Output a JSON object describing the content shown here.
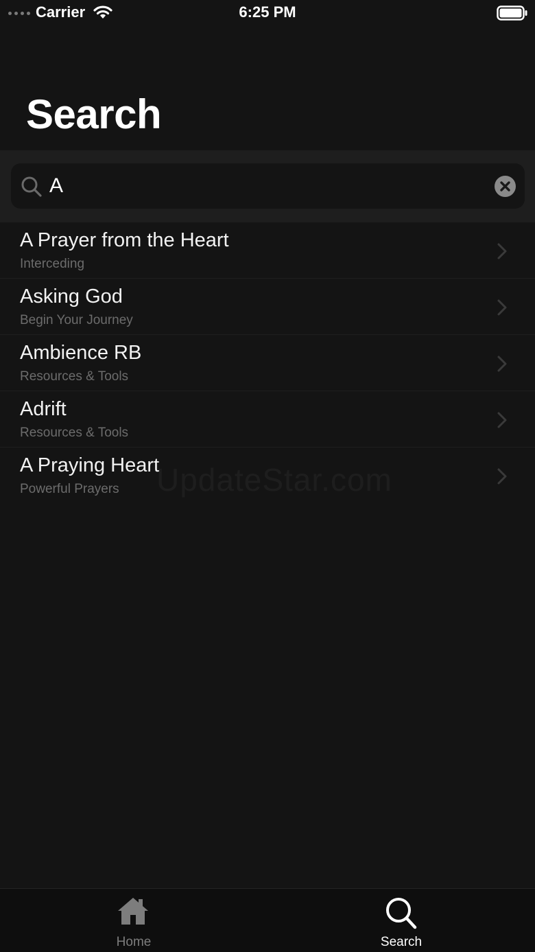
{
  "status_bar": {
    "carrier": "Carrier",
    "time": "6:25 PM"
  },
  "page": {
    "title": "Search"
  },
  "search": {
    "query": "A",
    "icon": "search-icon",
    "clear_icon": "clear-icon"
  },
  "results": [
    {
      "title": "A Prayer from the Heart",
      "subtitle": "Interceding"
    },
    {
      "title": "Asking God",
      "subtitle": "Begin Your Journey"
    },
    {
      "title": "Ambience RB",
      "subtitle": "Resources & Tools"
    },
    {
      "title": "Adrift",
      "subtitle": "Resources & Tools"
    },
    {
      "title": "A Praying Heart",
      "subtitle": "Powerful Prayers"
    }
  ],
  "watermark": "UpdateStar.com",
  "tab_bar": {
    "tabs": [
      {
        "label": "Home",
        "icon": "home-icon",
        "selected": false
      },
      {
        "label": "Search",
        "icon": "search-icon",
        "selected": true
      }
    ]
  },
  "colors": {
    "background": "#141414",
    "search_band": "#1e1e1e",
    "subtitle_text": "#6c6c6c",
    "tab_inactive": "#7d7d7d",
    "tab_active": "#ffffff"
  }
}
